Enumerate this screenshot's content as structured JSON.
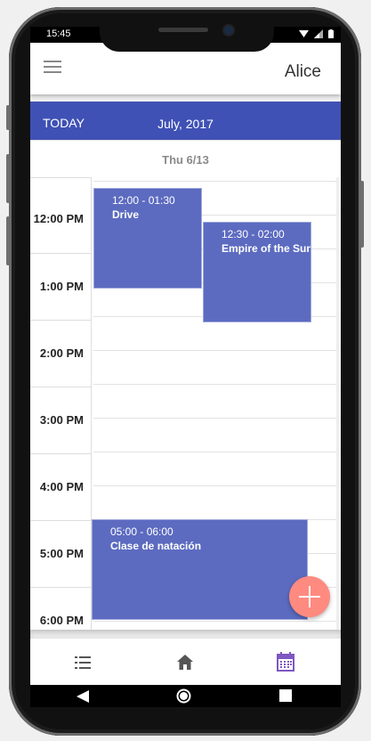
{
  "status": {
    "time": "15:45"
  },
  "app": {
    "user_name": "Alice"
  },
  "calendar": {
    "today_label": "TODAY",
    "month_label": "July, 2017",
    "day_label": "Thu 6/13",
    "hours": [
      "12:00 PM",
      "1:00 PM",
      "2:00 PM",
      "3:00 PM",
      "4:00 PM",
      "5:00 PM",
      "6:00 PM"
    ]
  },
  "events": [
    {
      "time": "12:00 - 01:30",
      "title": "Drive"
    },
    {
      "time": "12:30 - 02:00",
      "title": "Empire of the Sun"
    },
    {
      "time": "05:00 - 06:00",
      "title": "Clase de natación"
    }
  ],
  "nav": {
    "items": [
      "list-icon",
      "home-icon",
      "calendar-icon"
    ],
    "active_color": "#7e57c2"
  },
  "colors": {
    "header": "#3f51b5",
    "event": "#5c6bc0",
    "fab": "#ff8a80"
  }
}
